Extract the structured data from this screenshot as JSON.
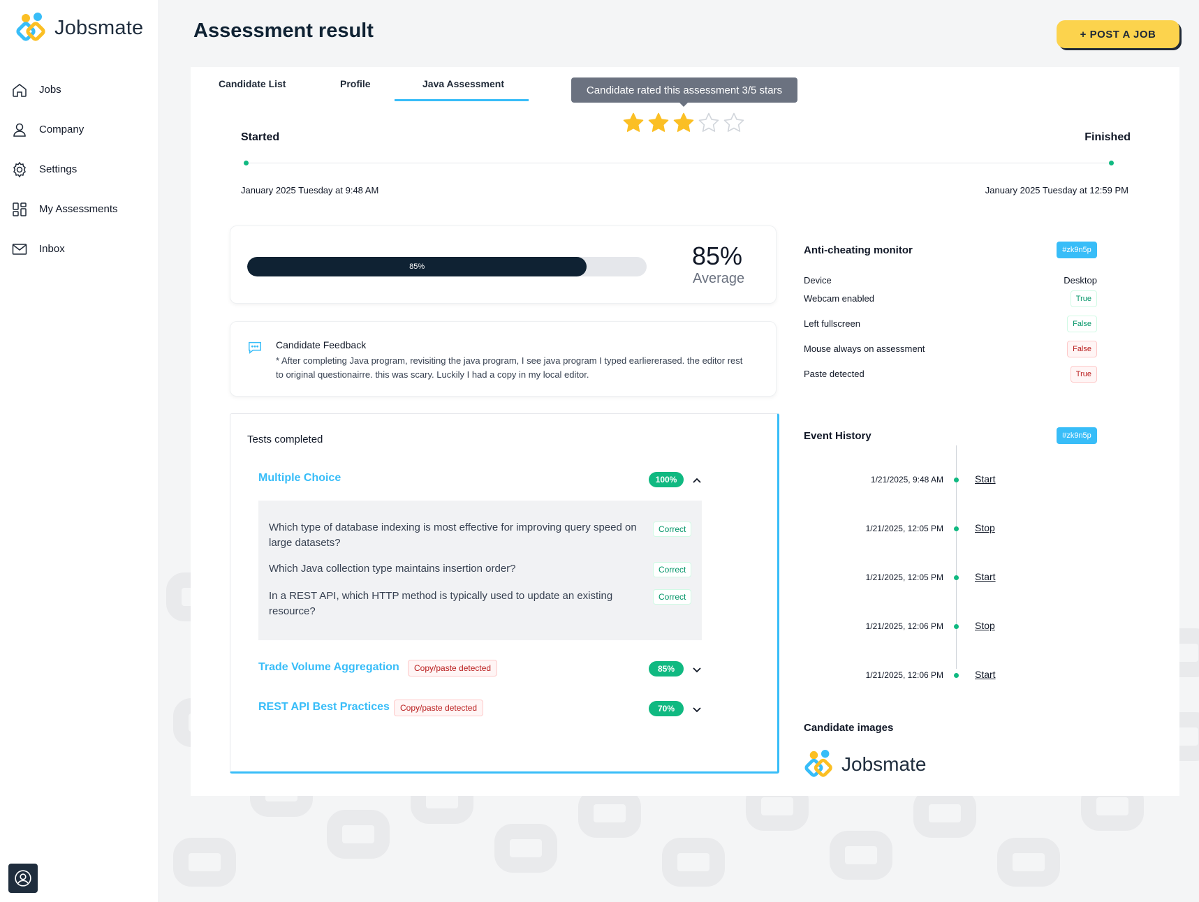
{
  "app": {
    "logo_text": "Jobsmate"
  },
  "sidebar": {
    "items": [
      {
        "label": "Jobs",
        "icon": "home-icon"
      },
      {
        "label": "Company",
        "icon": "user-icon"
      },
      {
        "label": "Settings",
        "icon": "gear-icon"
      },
      {
        "label": "My Assessments",
        "icon": "grid-icon"
      },
      {
        "label": "Inbox",
        "icon": "mail-icon"
      }
    ]
  },
  "header": {
    "title": "Assessment result",
    "post_job_label": "+ POST A JOB"
  },
  "tabs": [
    {
      "label": "Candidate List",
      "active": false
    },
    {
      "label": "Profile",
      "active": false
    },
    {
      "label": "Java Assessment",
      "active": true
    }
  ],
  "rating": {
    "tooltip": "Candidate rated this assessment 3/5 stars",
    "value": 3,
    "max": 5,
    "color": "#fbbf24"
  },
  "timeline": {
    "start_label": "Started",
    "end_label": "Finished",
    "start_date": "January 2025 Tuesday at 9:48 AM",
    "end_date": "January 2025 Tuesday at 12:59 PM"
  },
  "average": {
    "progress": 85,
    "progress_label": "85%",
    "value": "85%",
    "label": "Average"
  },
  "feedback": {
    "title": "Candidate Feedback",
    "text": "* After completing Java program, revisiting the java program, I see java program I typed earliererased. the editor rest to original questionairre. this was scary. Luckily I had a copy in my local editor."
  },
  "tests": {
    "title": "Tests completed",
    "items": [
      {
        "name": "Multiple Choice",
        "score": "100%",
        "expanded": true,
        "questions": [
          {
            "text": "Which type of database indexing is most effective for improving query speed on large datasets?",
            "status": "Correct"
          },
          {
            "text": "Which Java collection type maintains insertion order?",
            "status": "Correct"
          },
          {
            "text": "In a REST API, which HTTP method is typically used to update an existing resource?",
            "status": "Correct"
          }
        ]
      },
      {
        "name": "Trade Volume Aggregation",
        "score": "85%",
        "warning": "Copy/paste detected",
        "expanded": false
      },
      {
        "name": "REST API Best Practices",
        "score": "70%",
        "warning": "Copy/paste detected",
        "expanded": false
      }
    ]
  },
  "anti_cheating": {
    "title": "Anti-cheating monitor",
    "id": "#zk9n5p",
    "rows": [
      {
        "label": "Device",
        "value": "Desktop"
      },
      {
        "label": "Webcam enabled",
        "value": "True"
      },
      {
        "label": "Left fullscreen",
        "value": "False"
      },
      {
        "label": "Mouse always on assessment",
        "value": "False"
      },
      {
        "label": "Paste detected",
        "value": "True"
      }
    ]
  },
  "event_history": {
    "title": "Event History",
    "id": "#zk9n5p",
    "events": [
      {
        "time": "1/21/2025, 9:48 AM",
        "action": "Start"
      },
      {
        "time": "1/21/2025, 12:05 PM",
        "action": "Stop"
      },
      {
        "time": "1/21/2025, 12:05 PM",
        "action": "Start"
      },
      {
        "time": "1/21/2025, 12:06 PM",
        "action": "Stop"
      },
      {
        "time": "1/21/2025, 12:06 PM",
        "action": "Start"
      }
    ]
  },
  "candidate_images": {
    "title": "Candidate images",
    "logo_text": "Jobsmate"
  },
  "colors": {
    "accent": "#38bdf8",
    "primary_dark": "#0f2233",
    "success": "#10b981",
    "danger": "#b91c1c",
    "cta": "#fcd34d"
  }
}
